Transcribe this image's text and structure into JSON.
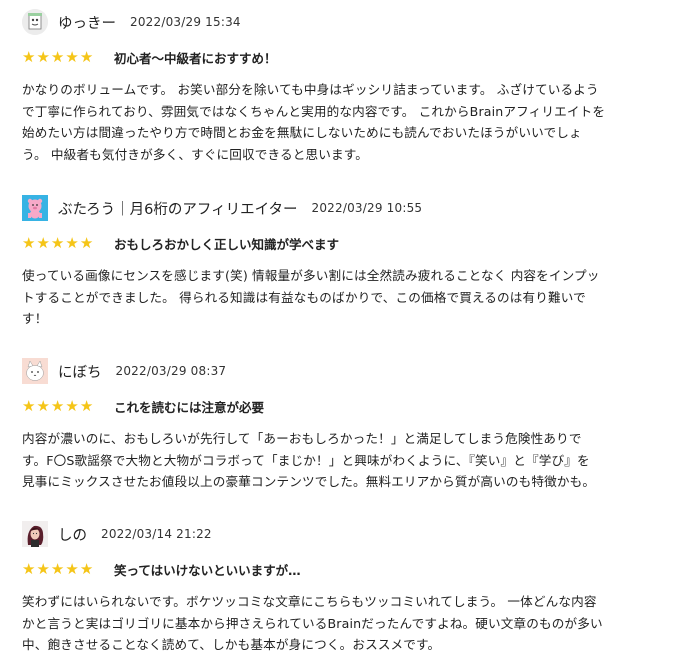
{
  "colors": {
    "star": "#f5c518",
    "text": "#222222"
  },
  "reviews": [
    {
      "avatar_icon": "sketch-character-avatar-icon",
      "name": "ゆっきー",
      "date": "2022/03/29 15:34",
      "rating": 5,
      "stars": [
        "★",
        "★",
        "★",
        "★",
        "★"
      ],
      "title": "初心者〜中級者におすすめ！",
      "body_lines": [
        "かなりのボリュームです。 お笑い部分を除いても中身はギッシリ詰まっています。 ふざけているよう",
        "で丁寧に作られており、雰囲気ではなくちゃんと実用的な内容です。 これからBrainアフィリエイトを",
        "始めたい方は間違ったやり方で時間とお金を無駄にしないためにも読んでおいたほうがいいでしょ",
        "う。 中級者も気付きが多く、すぐに回収できると思います。"
      ]
    },
    {
      "avatar_icon": "pink-pig-character-avatar-icon",
      "name": "ぶたろう｜月6桁のアフィリエイター",
      "date": "2022/03/29 10:55",
      "rating": 5,
      "stars": [
        "★",
        "★",
        "★",
        "★",
        "★"
      ],
      "title": "おもしろおかしく正しい知識が学べます",
      "body_lines": [
        "使っている画像にセンスを感じます(笑) 情報量が多い割には全然読み疲れることなく 内容をインプッ",
        "トすることができました。 得られる知識は有益なものばかりで、この価格で買えるのは有り難いで",
        "す！"
      ]
    },
    {
      "avatar_icon": "white-cat-avatar-icon",
      "name": "にぼち",
      "date": "2022/03/29 08:37",
      "rating": 5,
      "stars": [
        "★",
        "★",
        "★",
        "★",
        "★"
      ],
      "title": "これを読むには注意が必要",
      "body_lines": [
        "内容が濃いのに、おもしろいが先行して「あーおもしろかった！」と満足してしまう危険性ありで",
        "す。F〇S歌謡祭で大物と大物がコラボって「まじか！」と興味がわくように、『笑い』と『学び』を",
        "見事にミックスさせたお値段以上の豪華コンテンツでした。無料エリアから質が高いのも特徴かも。"
      ]
    },
    {
      "avatar_icon": "woman-portrait-avatar-icon",
      "name": "しの",
      "date": "2022/03/14 21:22",
      "rating": 5,
      "stars": [
        "★",
        "★",
        "★",
        "★",
        "★"
      ],
      "title": "笑ってはいけないといいますが…",
      "body_lines": [
        "笑わずにはいられないです。ボケツッコミな文章にこちらもツッコミいれてしまう。 一体どんな内容",
        "かと言うと実はゴリゴリに基本から押さえられているBrainだったんですよね。硬い文章のものが多い",
        "中、飽きさせることなく読めて、しかも基本が身につく。おススメです。"
      ]
    }
  ]
}
